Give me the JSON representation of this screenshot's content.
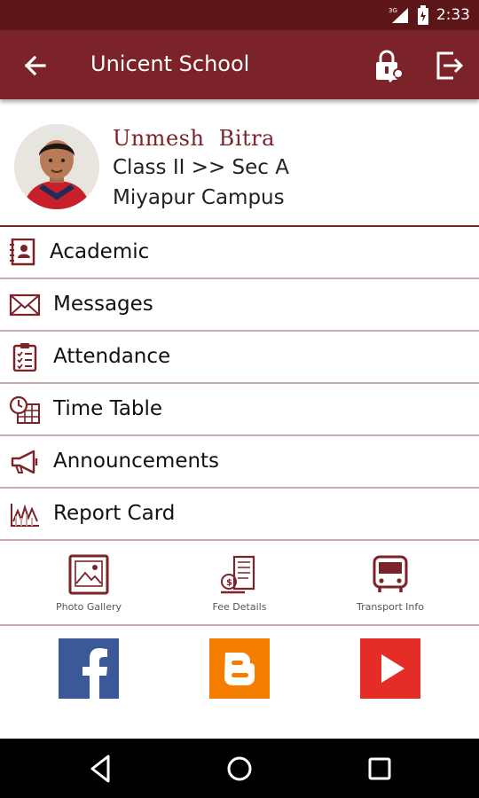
{
  "status_bar": {
    "time": "2:33",
    "network": "3G",
    "icons": [
      "signal-icon",
      "battery-icon"
    ]
  },
  "app_bar": {
    "title": "Unicent School",
    "back_icon": "arrow-left-icon",
    "actions": [
      "lock-key-icon",
      "logout-icon"
    ]
  },
  "profile": {
    "name": "Unmesh  Bitra",
    "class_section": "Class II >> Sec A",
    "campus": "Miyapur Campus"
  },
  "menu": [
    {
      "label": "Academic",
      "icon": "contact-book-icon"
    },
    {
      "label": "Messages",
      "icon": "envelope-icon"
    },
    {
      "label": "Attendance",
      "icon": "clipboard-checklist-icon"
    },
    {
      "label": "Time Table",
      "icon": "clock-calendar-icon"
    },
    {
      "label": "Announcements",
      "icon": "megaphone-icon"
    },
    {
      "label": "Report Card",
      "icon": "chart-icon"
    }
  ],
  "shortcuts": [
    {
      "label": "Photo Gallery",
      "icon": "picture-frame-icon"
    },
    {
      "label": "Fee Details",
      "icon": "fee-receipt-icon"
    },
    {
      "label": "Transport Info",
      "icon": "bus-icon"
    }
  ],
  "social": [
    {
      "name": "facebook",
      "color": "#3b5998"
    },
    {
      "name": "blogger",
      "color": "#f57d00"
    },
    {
      "name": "youtube",
      "color": "#e52d27"
    }
  ],
  "colors": {
    "primary": "#7b2328",
    "status_bar": "#5d1618",
    "divider": "#c9a9aa"
  }
}
